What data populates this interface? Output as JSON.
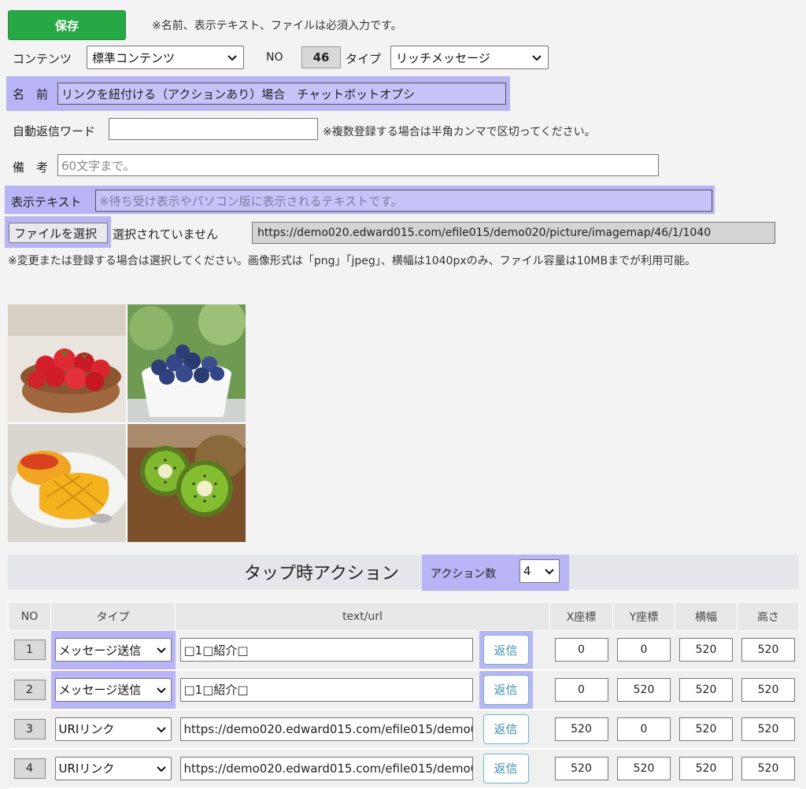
{
  "toolbar": {
    "save_label": "保存",
    "required_note": "※名前、表示テキスト、ファイルは必須入力です。"
  },
  "form": {
    "content_label": "コンテンツ",
    "content_value": "標準コンテンツ",
    "no_label": "NO",
    "no_value": "46",
    "type_label": "タイプ",
    "type_value": "リッチメッセージ",
    "name_label": "名　前",
    "name_value": "リンクを紐付ける（アクションあり）場合　チャットボットオプシ",
    "auto_reply_label": "自動返信ワード",
    "auto_reply_value": "",
    "auto_reply_note": "※複数登録する場合は半角カンマで区切ってください。",
    "memo_label": "備　考",
    "memo_placeholder": "60文字まで。",
    "display_label": "表示テキスト",
    "display_placeholder": "※待ち受け表示やパソコン版に表示されるテキストです。",
    "file_button": "ファイルを選択",
    "file_status": "選択されていません",
    "file_url": "https://demo020.edward015.com/efile015/demo020/picture/imagemap/46/1/1040",
    "file_note": "※変更または登録する場合は選択してください。画像形式は「png」「jpeg」、横幅は1040pxのみ、ファイル容量は10MBまでが利用可能。"
  },
  "image_preview": {
    "tiles": [
      "strawberries",
      "blueberries",
      "mango",
      "kiwi"
    ]
  },
  "actions": {
    "title": "タップ時アクション",
    "count_label": "アクション数",
    "count_value": "4",
    "columns": [
      "NO",
      "タイプ",
      "text/url",
      "X座標",
      "Y座標",
      "横幅",
      "高さ"
    ],
    "reply_label": "返信",
    "rows": [
      {
        "no": "1",
        "type": "メッセージ送信",
        "text": "□1□紹介□",
        "x": "0",
        "y": "0",
        "w": "520",
        "h": "520"
      },
      {
        "no": "2",
        "type": "メッセージ送信",
        "text": "□1□紹介□",
        "x": "0",
        "y": "520",
        "w": "520",
        "h": "520"
      },
      {
        "no": "3",
        "type": "URIリンク",
        "text": "https://demo020.edward015.com/efile015/demo0",
        "x": "520",
        "y": "0",
        "w": "520",
        "h": "520"
      },
      {
        "no": "4",
        "type": "URIリンク",
        "text": "https://demo020.edward015.com/efile015/demo0",
        "x": "520",
        "y": "520",
        "w": "520",
        "h": "520"
      }
    ]
  },
  "colors": {
    "accent_green": "#28a745",
    "highlight": "#b8b4f5",
    "reply_border": "#6ab7c7"
  }
}
